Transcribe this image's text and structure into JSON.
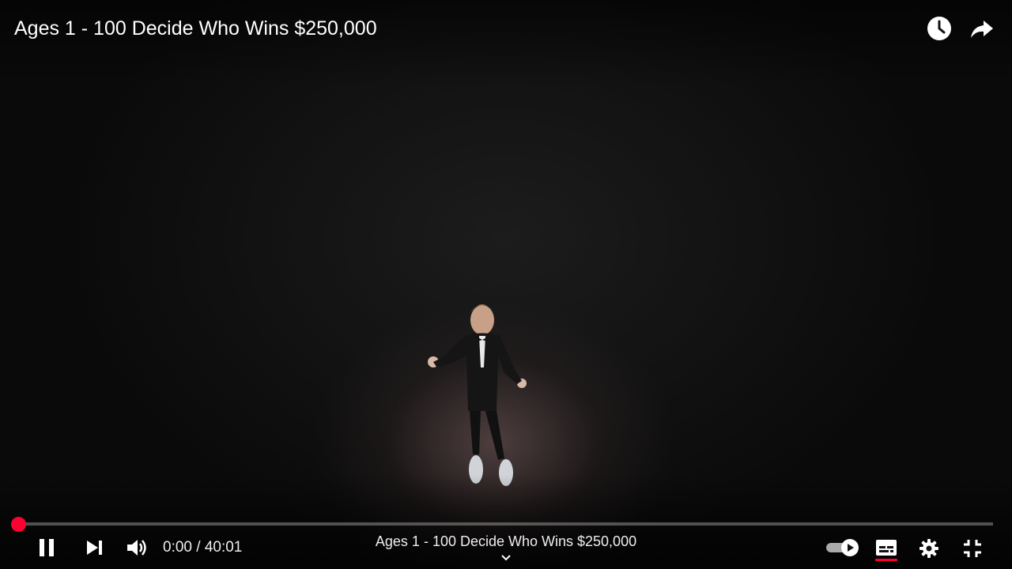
{
  "video": {
    "title": "Ages 1 - 100 Decide Who Wins $250,000",
    "chapter_title": "Ages 1 - 100 Decide Who Wins $250,000",
    "current_time": "0:00",
    "time_separator": " / ",
    "duration": "40:01",
    "progress_fraction": 0.0
  },
  "top_actions": {
    "watch_later_icon": "clock-icon",
    "share_icon": "share-arrow-icon"
  },
  "controls": {
    "left": [
      "pause-icon",
      "next-icon",
      "volume-icon"
    ],
    "right": [
      "autoplay-toggle",
      "subtitles-icon",
      "settings-gear-icon",
      "exit-fullscreen-icon"
    ],
    "autoplay_on": true,
    "subtitles_active": true
  },
  "colors": {
    "accent": "#ff0033",
    "text": "#ffffff"
  }
}
